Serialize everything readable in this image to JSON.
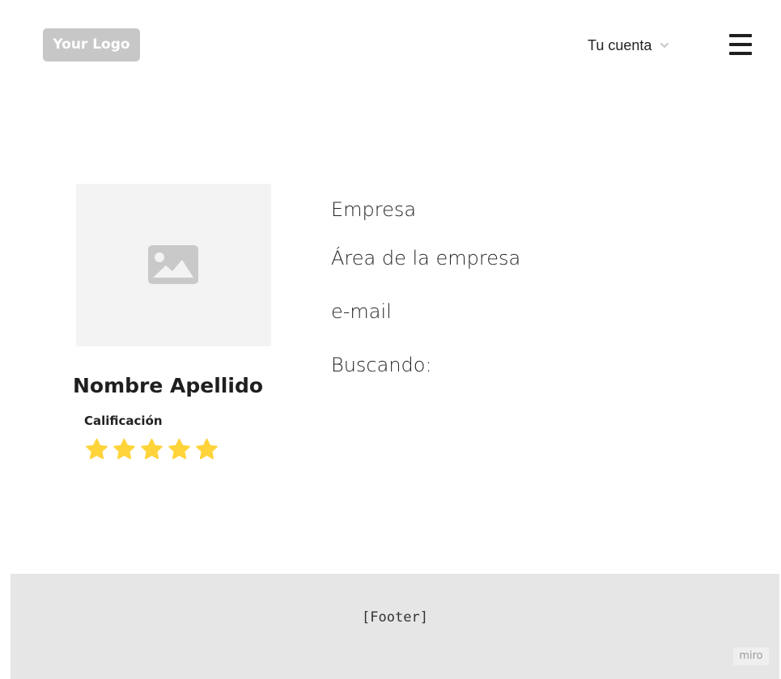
{
  "header": {
    "logo_text": "Your Logo",
    "account_label": "Tu cuenta",
    "account_icon": "chevron-down-icon",
    "menu_icon": "hamburger-menu-icon"
  },
  "profile": {
    "photo_icon": "image-placeholder-icon",
    "name": "Nombre Apellido",
    "rating_label": "Calificación",
    "rating": 5,
    "rating_max": 5,
    "star_color": "#ffd43b"
  },
  "details": {
    "company": "Empresa",
    "company_area": "Área de la empresa",
    "email": "e-mail",
    "seeking": "Buscando:"
  },
  "footer": {
    "text": "[Footer]",
    "watermark": "miro"
  }
}
